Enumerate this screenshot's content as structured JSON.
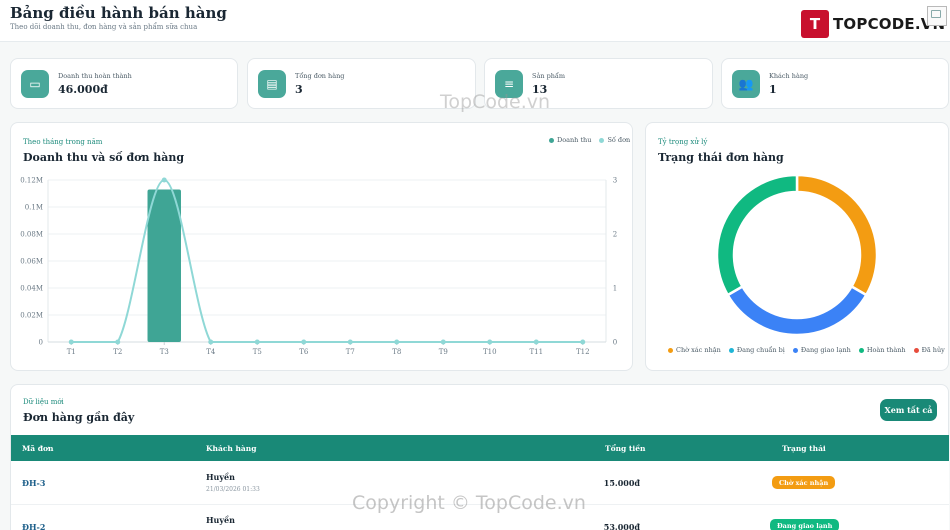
{
  "header": {
    "title": "Bảng điều hành bán hàng",
    "subtitle": "Theo dõi doanh thu, đơn hàng và sản phẩm sữa chua",
    "brand_mark": "T",
    "brand_text": "TOPCODE.VN"
  },
  "stats": [
    {
      "label": "Doanh thu hoàn thành",
      "value": "46.000đ",
      "icon": "wallet-icon",
      "glyph": "▭"
    },
    {
      "label": "Tổng đơn hàng",
      "value": "3",
      "icon": "box-icon",
      "glyph": "▤"
    },
    {
      "label": "Sản phẩm",
      "value": "13",
      "icon": "database-icon",
      "glyph": "≡"
    },
    {
      "label": "Khách hàng",
      "value": "1",
      "icon": "users-icon",
      "glyph": "👥"
    }
  ],
  "revenue_panel": {
    "eyebrow": "Theo tháng trong năm",
    "title": "Doanh thu và số đơn hàng",
    "legend": [
      {
        "label": "Doanh thu",
        "color": "#3fa595"
      },
      {
        "label": "Số đơn",
        "color": "#8fd8d6"
      }
    ]
  },
  "status_panel": {
    "eyebrow": "Tỷ trọng xử lý",
    "title": "Trạng thái đơn hàng",
    "legend": [
      {
        "label": "Chờ xác nhận",
        "color": "#f39c12"
      },
      {
        "label": "Đang chuẩn bị",
        "color": "#1fb5d6"
      },
      {
        "label": "Đang giao lạnh",
        "color": "#3b82f6"
      },
      {
        "label": "Hoàn thành",
        "color": "#10b981"
      },
      {
        "label": "Đã hủy",
        "color": "#e74c3c"
      }
    ]
  },
  "chart_data": [
    {
      "type": "bar",
      "categories": [
        "T1",
        "T2",
        "T3",
        "T4",
        "T5",
        "T6",
        "T7",
        "T8",
        "T9",
        "T10",
        "T11",
        "T12"
      ],
      "series": [
        {
          "name": "Doanh thu",
          "type": "bar",
          "axis": "left",
          "values": [
            0,
            0,
            113000,
            0,
            0,
            0,
            0,
            0,
            0,
            0,
            0,
            0
          ],
          "color": "#3fa595"
        },
        {
          "name": "Số đơn",
          "type": "line",
          "axis": "right",
          "values": [
            0,
            0,
            3,
            0,
            0,
            0,
            0,
            0,
            0,
            0,
            0,
            0
          ],
          "color": "#8fd8d6"
        }
      ],
      "y_left_ticks": [
        "0",
        "0.02M",
        "0.04M",
        "0.06M",
        "0.08M",
        "0.1M",
        "0.12M"
      ],
      "y_left_range": [
        0,
        120000
      ],
      "y_right_ticks": [
        "0",
        "1",
        "2",
        "3"
      ],
      "y_right_range": [
        0,
        3
      ],
      "grid": true,
      "legend_position": "top-right"
    },
    {
      "type": "pie",
      "donut": true,
      "labels": [
        "Chờ xác nhận",
        "Đang chuẩn bị",
        "Đang giao lạnh",
        "Hoàn thành",
        "Đã hủy"
      ],
      "values": [
        1,
        0,
        1,
        1,
        0
      ],
      "colors": [
        "#f39c12",
        "#1fb5d6",
        "#3b82f6",
        "#10b981",
        "#e74c3c"
      ],
      "legend_position": "bottom"
    }
  ],
  "orders": {
    "eyebrow": "Dữ liệu mới",
    "title": "Đơn hàng gần đây",
    "view_all": "Xem tất cả",
    "columns": [
      "Mã đơn",
      "Khách hàng",
      "Tổng tiền",
      "Trạng thái"
    ],
    "rows": [
      {
        "code": "ĐH-3",
        "customer": "Huyền",
        "time": "21/03/2026 01:33",
        "total": "15.000đ",
        "status": "Chờ xác nhận",
        "status_color": "#f39c12"
      },
      {
        "code": "ĐH-2",
        "customer": "Huyền",
        "time": "",
        "total": "53.000đ",
        "status": "Đang giao lạnh",
        "status_color": "#10b981"
      }
    ]
  },
  "watermarks": [
    "TopCode.vn",
    "Copyright © TopCode.vn"
  ]
}
